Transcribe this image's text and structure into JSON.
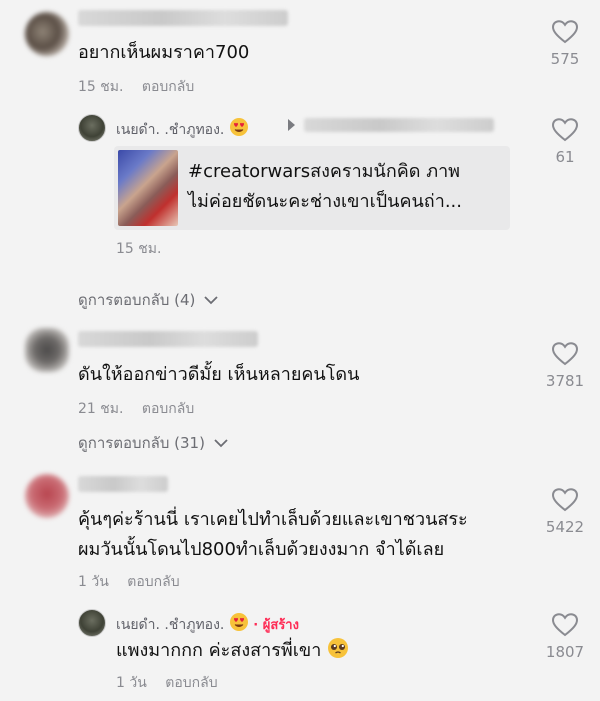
{
  "comments": [
    {
      "text": "อยากเห็นผมราคา700",
      "time": "15 ชม.",
      "reply": "ตอบกลับ",
      "likes": "575",
      "view_replies": "ดูการตอบกลับ (4)",
      "replies": [
        {
          "name": "เนยดำ. .ชำภูทอง.",
          "emoji": "heart-eyes",
          "likes": "61",
          "card_lines": [
            "#creatorwarsสงครามนักคิด ภาพ",
            "ไม่ค่อยชัดนะคะช่างเขาเป็นคนถ่า..."
          ],
          "time": "15 ชม."
        }
      ]
    },
    {
      "text": "ดันให้ออกข่าวดีมั้ย เห็นหลายคนโดน",
      "time": "21 ชม.",
      "reply": "ตอบกลับ",
      "likes": "3781",
      "view_replies": "ดูการตอบกลับ (31)"
    },
    {
      "text_lines": [
        "คุ้นๆค่ะร้านนี่ เราเคยไปทำเล็บด้วยและเขาชวนสระ",
        "ผมวันนั้นโดนไป800ทำเล็บด้วยงงมาก จำได้เลย"
      ],
      "time": "1 วัน",
      "reply": "ตอบกลับ",
      "likes": "5422",
      "replies": [
        {
          "name": "เนยดำ. .ชำภูทอง.",
          "emoji": "heart-eyes",
          "creator_tag": "· ผู้สร้าง",
          "text": "แพงมากกก ค่ะสงสารพี่เขา",
          "text_emoji": "pleading-face",
          "time": "1 วัน",
          "reply": "ตอบกลับ",
          "likes": "1807"
        }
      ]
    }
  ],
  "colors": {
    "background": "#f3f3f3",
    "meta": "#8a8b91",
    "creator": "#fe2c55"
  }
}
